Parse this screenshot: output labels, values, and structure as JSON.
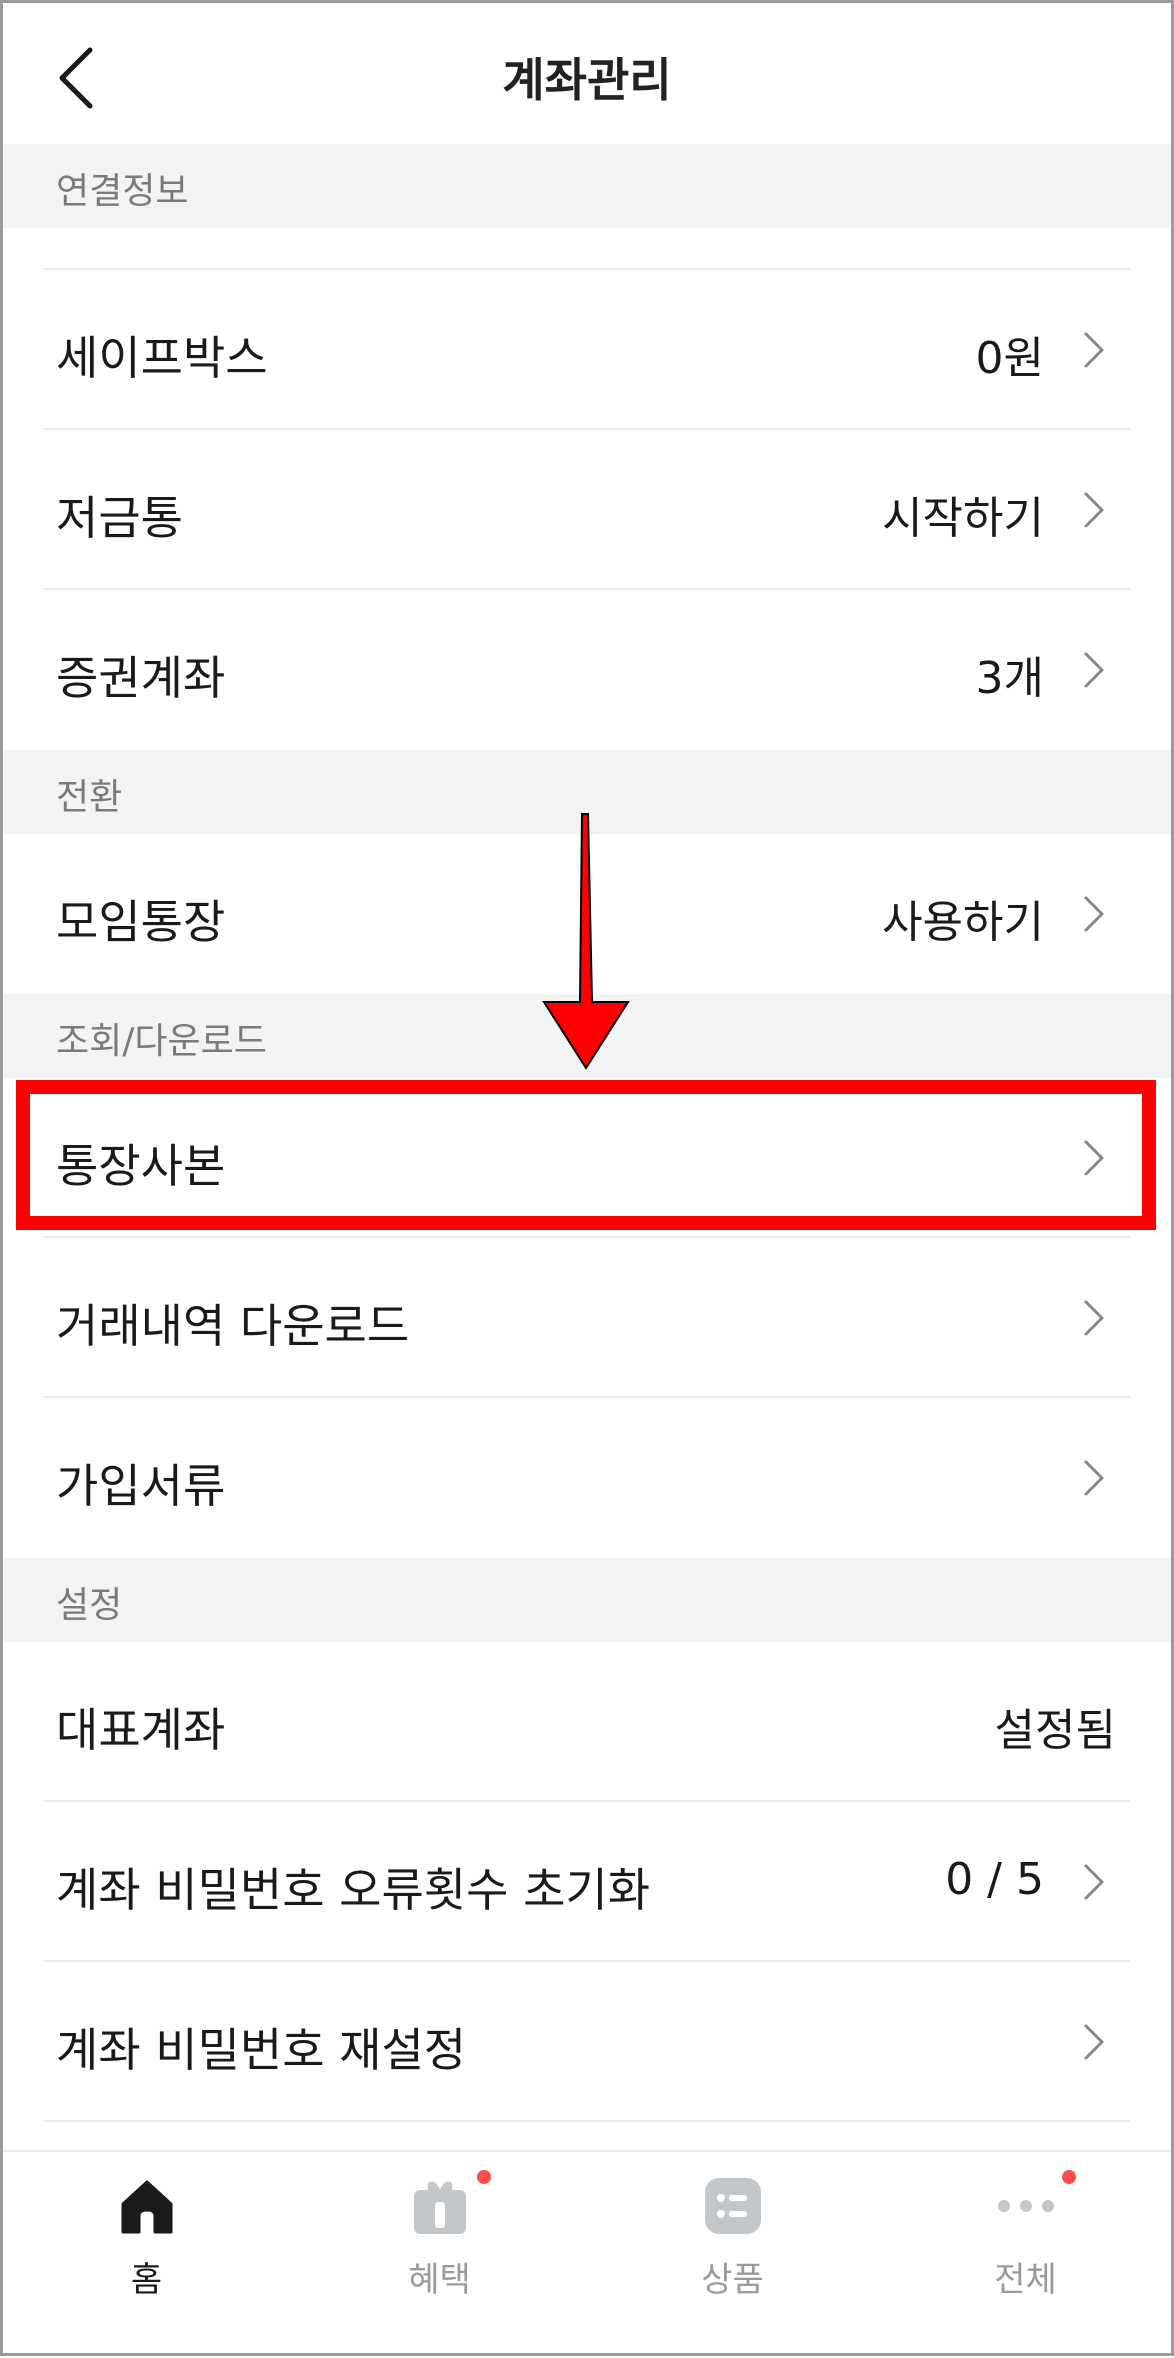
{
  "header": {
    "title": "계좌관리"
  },
  "sections": {
    "link": {
      "title": "연결정보",
      "items": [
        {
          "label": "세이프박스",
          "value": "0원"
        },
        {
          "label": "저금통",
          "value": "시작하기"
        },
        {
          "label": "증권계좌",
          "value": "3개"
        }
      ]
    },
    "convert": {
      "title": "전환",
      "items": [
        {
          "label": "모임통장",
          "value": "사용하기"
        }
      ]
    },
    "download": {
      "title": "조회/다운로드",
      "items": [
        {
          "label": "통장사본",
          "value": ""
        },
        {
          "label": "거래내역 다운로드",
          "value": ""
        },
        {
          "label": "가입서류",
          "value": ""
        }
      ]
    },
    "settings": {
      "title": "설정",
      "items": [
        {
          "label": "대표계좌",
          "value": "설정됨"
        },
        {
          "label": "계좌 비밀번호 오류횟수 초기화",
          "value": "0 / 5"
        },
        {
          "label": "계좌 비밀번호 재설정",
          "value": ""
        }
      ]
    }
  },
  "tabbar": {
    "items": [
      {
        "label": "홈",
        "icon": "home-icon",
        "active": true
      },
      {
        "label": "혜택",
        "icon": "gift-icon",
        "badge": true
      },
      {
        "label": "상품",
        "icon": "list-icon"
      },
      {
        "label": "전체",
        "icon": "more-icon",
        "badge": true
      }
    ]
  },
  "colors": {
    "highlight": "#ff0000",
    "badge": "#ff4d4d",
    "section_bg": "#f2f3f3"
  }
}
